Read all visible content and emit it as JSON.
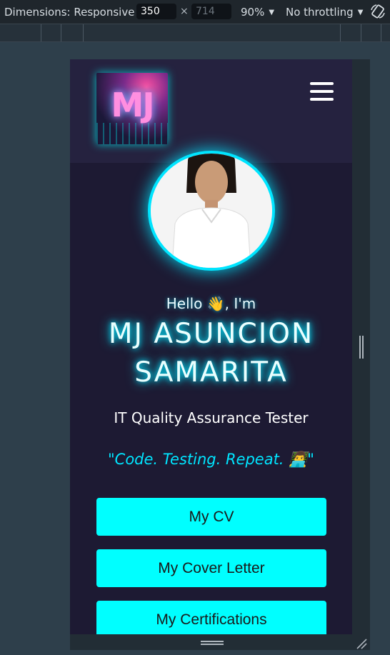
{
  "devtools": {
    "dimensions_label": "Dimensions: Responsive",
    "width_value": "350",
    "height_value": "714",
    "times": "×",
    "zoom": "90%",
    "throttling": "No throttling"
  },
  "site": {
    "logo_text": "MJ",
    "greeting": "Hello 👋, I'm",
    "name_line1": "MJ ASUNCION",
    "name_line2": "SAMARITA",
    "role": "IT Quality Assurance Tester",
    "motto": "\"Code. Testing. Repeat. 👨‍💻\"",
    "buttons": [
      {
        "label": "My CV"
      },
      {
        "label": "My Cover Letter"
      },
      {
        "label": "My Certifications"
      }
    ]
  },
  "colors": {
    "accent": "#00ffff",
    "page_bg": "#1d1a33",
    "header_bg": "#25223f"
  }
}
